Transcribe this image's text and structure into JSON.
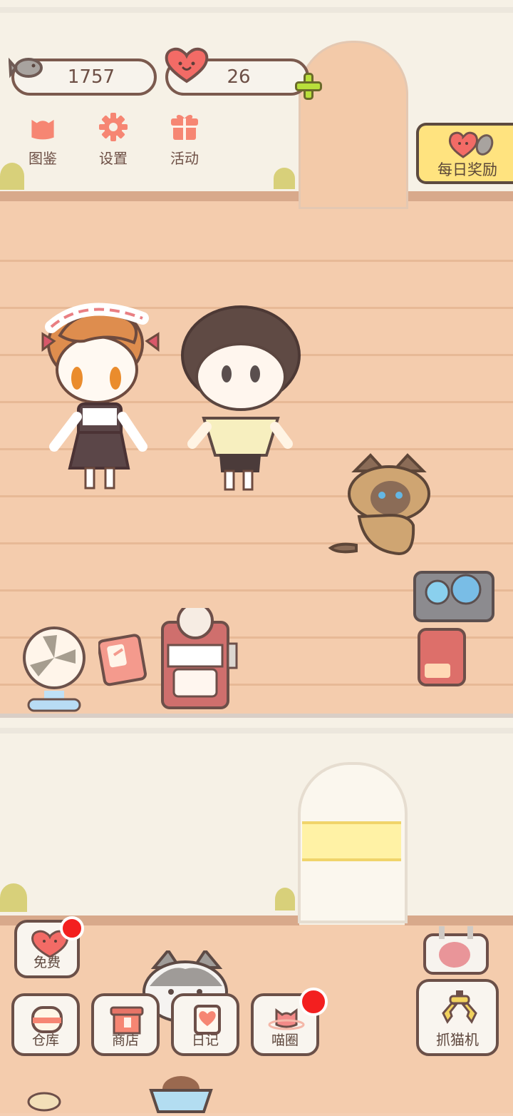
{
  "currency": {
    "fish": "1757",
    "hearts": "26"
  },
  "top_menu": {
    "collection": "图鉴",
    "settings": "设置",
    "events": "活动"
  },
  "daily_reward": {
    "label": "每日奖励"
  },
  "bottom_menu": {
    "free": "免费",
    "warehouse": "仓库",
    "shop": "商店",
    "diary": "日记",
    "circle": "喵圈",
    "claw_machine": "抓猫机"
  },
  "colors": {
    "accent": "#f68673",
    "reward_banner": "#ffe37f",
    "notification": "#f31f1f",
    "plus": "#b9df3b"
  }
}
